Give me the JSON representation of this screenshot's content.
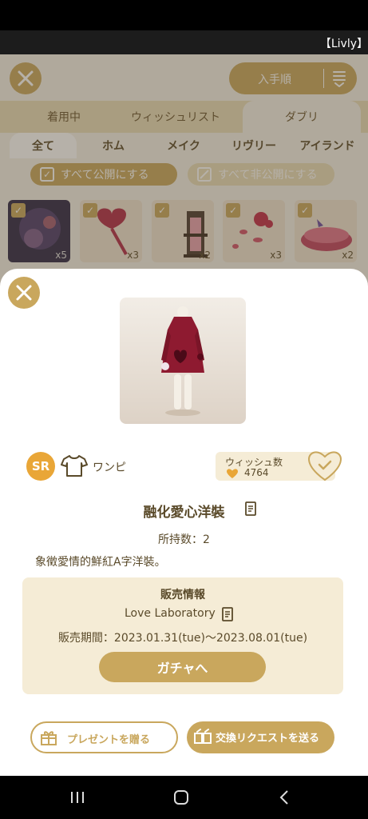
{
  "window": {
    "title": "【Livly】"
  },
  "header": {
    "sort_label": "入手順"
  },
  "tabs": [
    {
      "label": "着用中"
    },
    {
      "label": "ウィッシュリスト"
    },
    {
      "label": "ダブリ"
    }
  ],
  "subtabs": [
    {
      "label": "全て"
    },
    {
      "label": "ホム"
    },
    {
      "label": "メイク"
    },
    {
      "label": "リヴリー"
    },
    {
      "label": "アイランド"
    }
  ],
  "public_buttons": {
    "all_public": "すべて公開にする",
    "all_private": "すべて非公開にする"
  },
  "grid_items": [
    {
      "count": "x5"
    },
    {
      "count": "x3"
    },
    {
      "count": "x2"
    },
    {
      "count": "x3"
    },
    {
      "count": "x2"
    }
  ],
  "item": {
    "rarity": "SR",
    "category": "ワンピ",
    "category_icon": "shirt-icon",
    "wish_label": "ウィッシュ数",
    "wish_count": "4764",
    "name": "融化愛心洋裝",
    "owned": "所持数：2",
    "description": "象徵愛情的鮮紅A字洋裝。"
  },
  "sale": {
    "title": "販売情報",
    "source": "Love Laboratory",
    "period": "販売期間：2023.01.31(tue)〜2023.08.01(tue)",
    "gacha_label": "ガチャへ"
  },
  "actions": {
    "present_label": "プレゼントを贈る",
    "trade_label": "交換リクエストを送る"
  },
  "colors": {
    "accent": "#c9a75d",
    "rarity_sr": "#e9a637",
    "panel": "#f5ecd6"
  }
}
